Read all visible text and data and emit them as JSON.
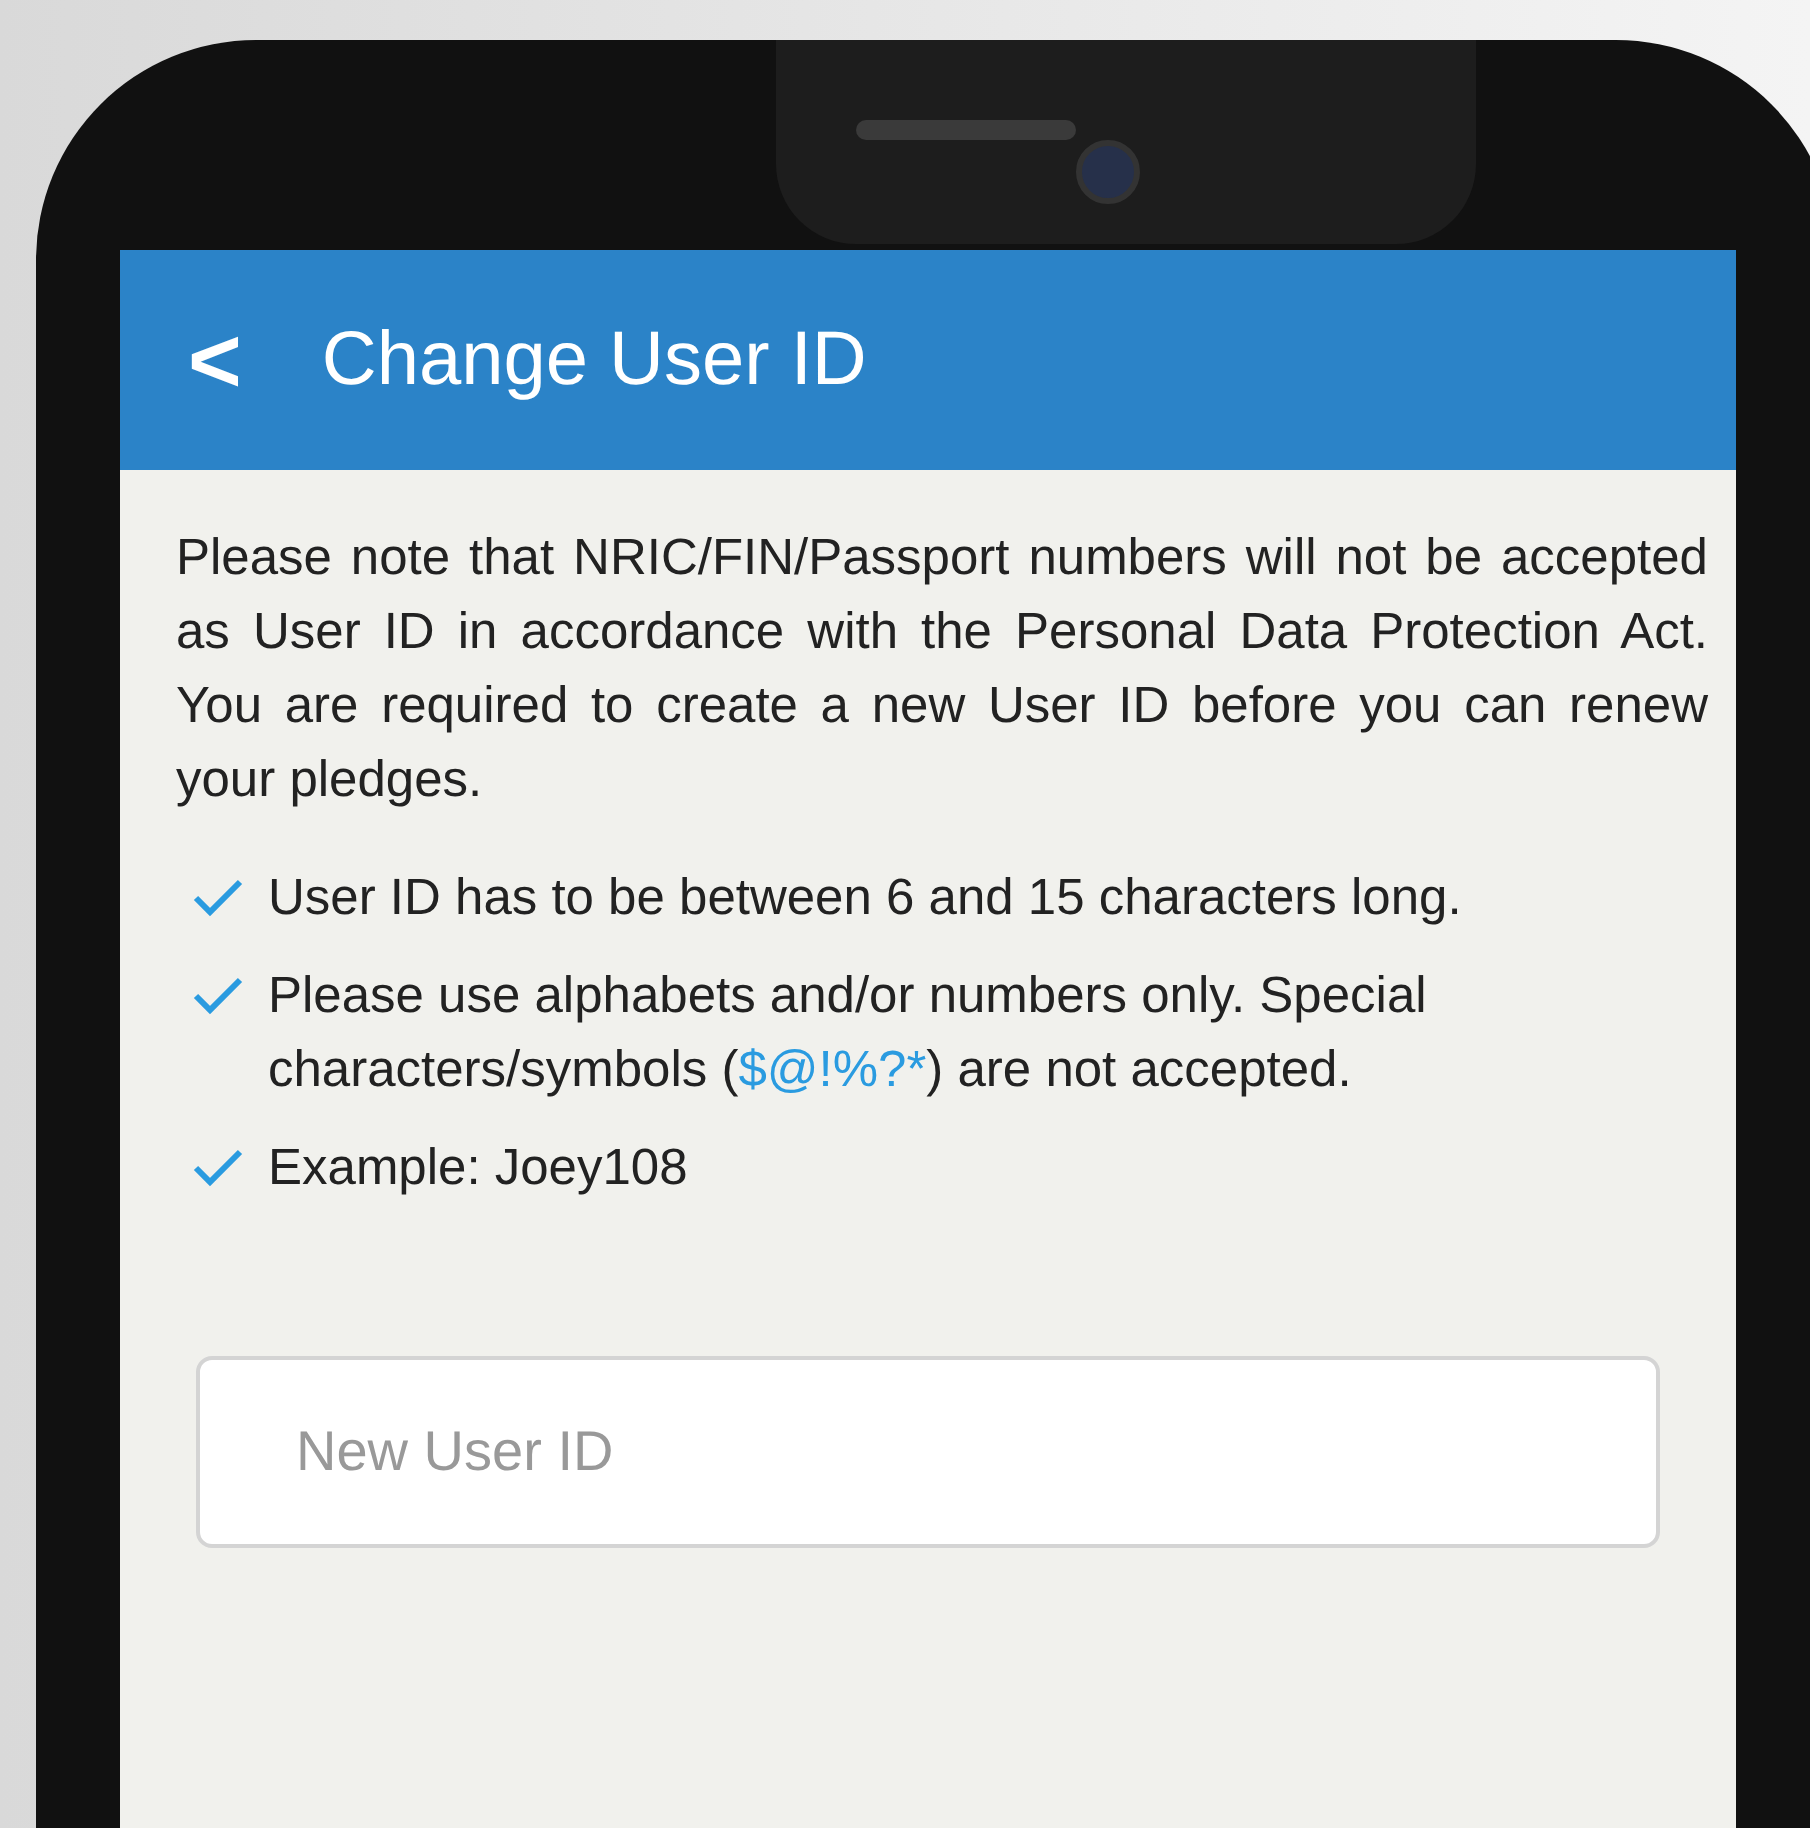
{
  "header": {
    "back": "<",
    "title": "Change User ID"
  },
  "notice": "Please note that NRIC/FIN/Passport numbers will not be accepted as User ID in accordance with the Personal Data Protection Act. You are required to create a new User ID before you can renew your pledges.",
  "rules": [
    {
      "checked": true,
      "parts": [
        {
          "kind": "plain",
          "text": "User ID has to be between 6 and 15 characters long."
        }
      ]
    },
    {
      "checked": true,
      "parts": [
        {
          "kind": "plain",
          "text": "Please use alphabets and/or numbers only. Special characters/symbols ("
        },
        {
          "kind": "highlight",
          "text": "$@!%?*"
        },
        {
          "kind": "plain",
          "text": ") are not accepted."
        }
      ]
    },
    {
      "checked": true,
      "parts": [
        {
          "kind": "plain",
          "text": "Example: Joey108"
        }
      ]
    }
  ],
  "field": {
    "placeholder": "New User ID"
  }
}
